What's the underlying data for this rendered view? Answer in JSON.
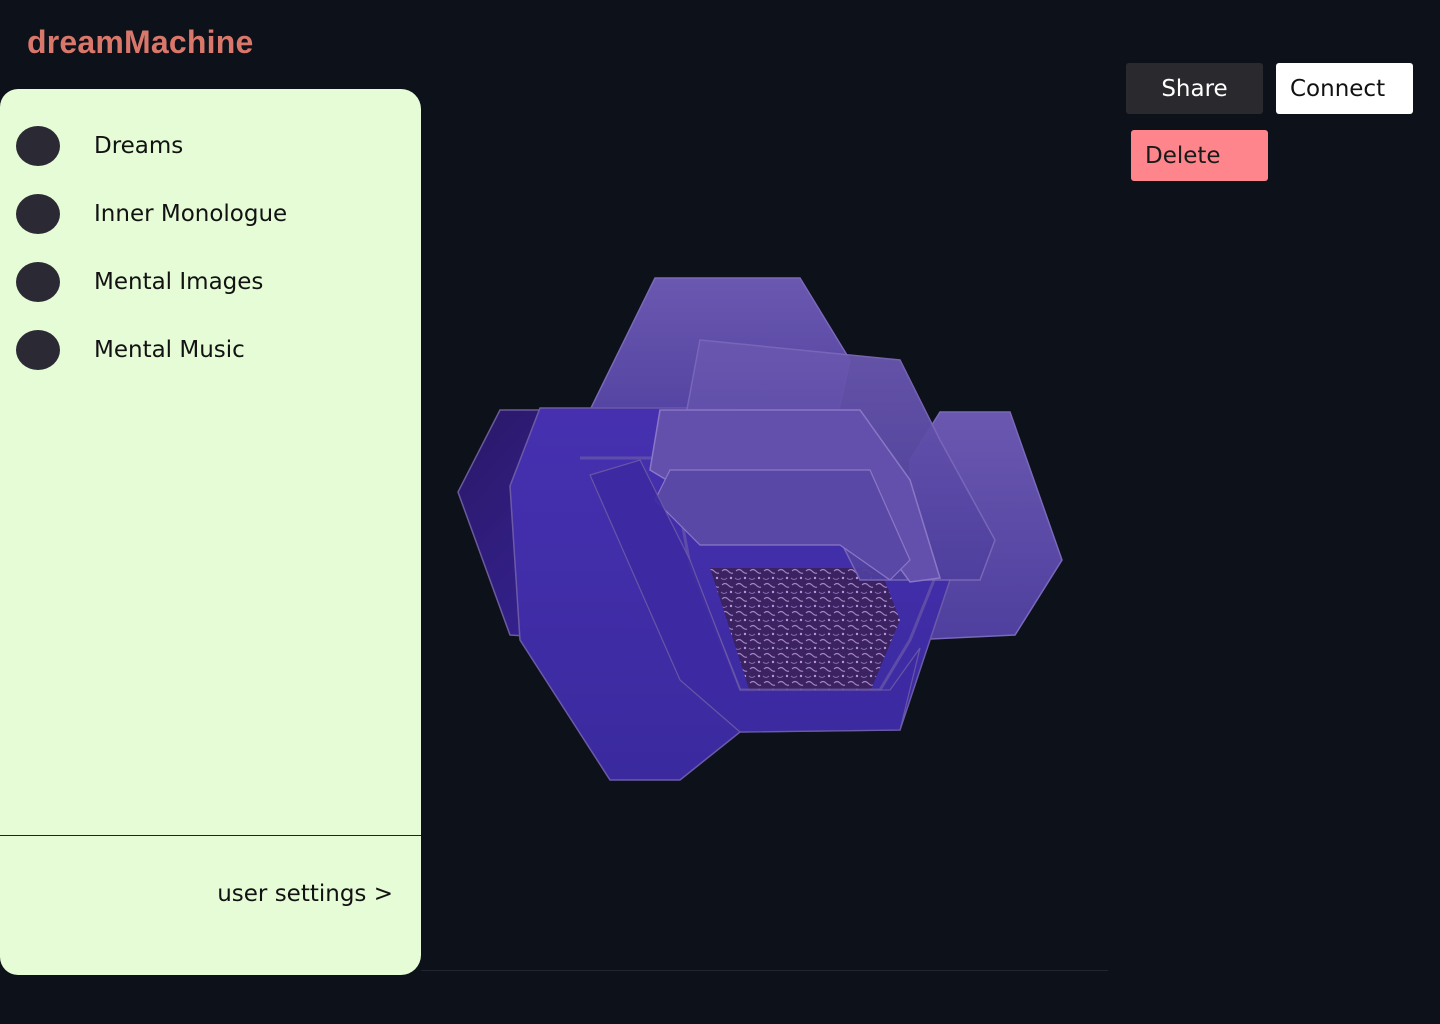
{
  "app": {
    "logo": "dreamMachine"
  },
  "sidebar": {
    "items": [
      {
        "label": "Dreams"
      },
      {
        "label": "Inner Monologue"
      },
      {
        "label": "Mental Images"
      },
      {
        "label": "Mental Music"
      }
    ],
    "user_settings": "user settings >"
  },
  "toolbar": {
    "share_label": "Share",
    "connect_label": "Connect",
    "delete_label": "Delete"
  },
  "colors": {
    "background": "#0c111a",
    "logo": "#d9776b",
    "sidebar": "#e5fcd7",
    "dot": "#2b2933",
    "share": "#2a2a2e",
    "connect": "#ffffff",
    "delete": "#fd858b",
    "shape_light": "#5f4ea6",
    "shape_dark": "#3d2c9a"
  }
}
